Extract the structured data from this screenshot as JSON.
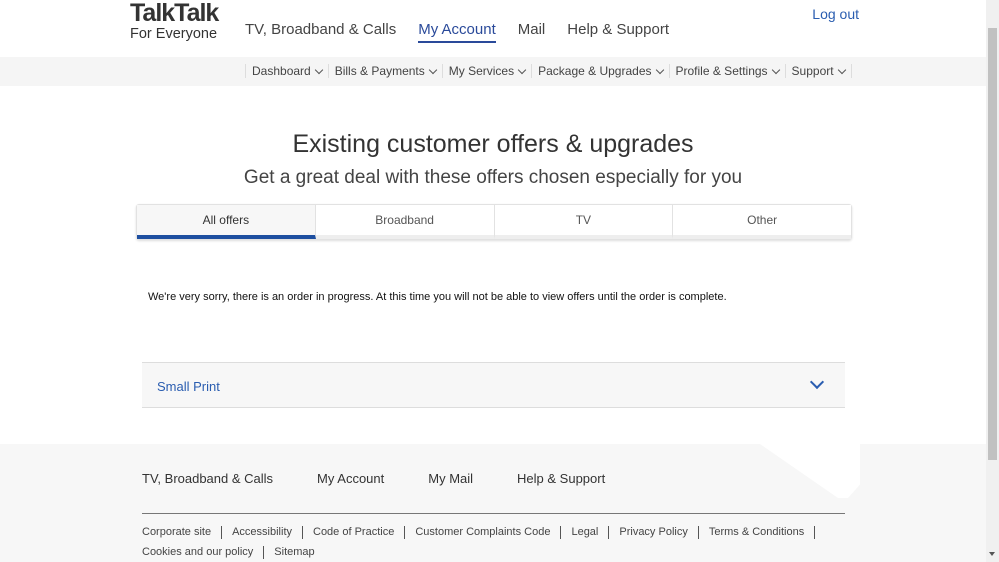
{
  "header": {
    "logo_main": "TalkTalk",
    "logo_sub": "For Everyone",
    "nav": [
      "TV, Broadband & Calls",
      "My Account",
      "Mail",
      "Help & Support"
    ],
    "active_nav": "My Account",
    "logout": "Log out"
  },
  "subnav": [
    "Dashboard",
    "Bills & Payments",
    "My Services",
    "Package & Upgrades",
    "Profile & Settings",
    "Support"
  ],
  "main": {
    "title": "Existing customer offers & upgrades",
    "subtitle": "Get a great deal with these offers chosen especially for you",
    "tabs": [
      "All offers",
      "Broadband",
      "TV",
      "Other"
    ],
    "active_tab": "All offers",
    "message": "We're very sorry, there is an order in progress. At this time you will not be able to view offers until the order is complete.",
    "small_print": "Small Print"
  },
  "footer": {
    "nav": [
      "TV, Broadband & Calls",
      "My Account",
      "My Mail",
      "Help & Support"
    ],
    "links": [
      "Corporate site",
      "Accessibility",
      "Code of Practice",
      "Customer Complaints Code",
      "Legal",
      "Privacy Policy",
      "Terms & Conditions",
      "Cookies and our policy",
      "Sitemap"
    ]
  },
  "colors": {
    "accent": "#1e4fa0",
    "link": "#2a5db0"
  }
}
